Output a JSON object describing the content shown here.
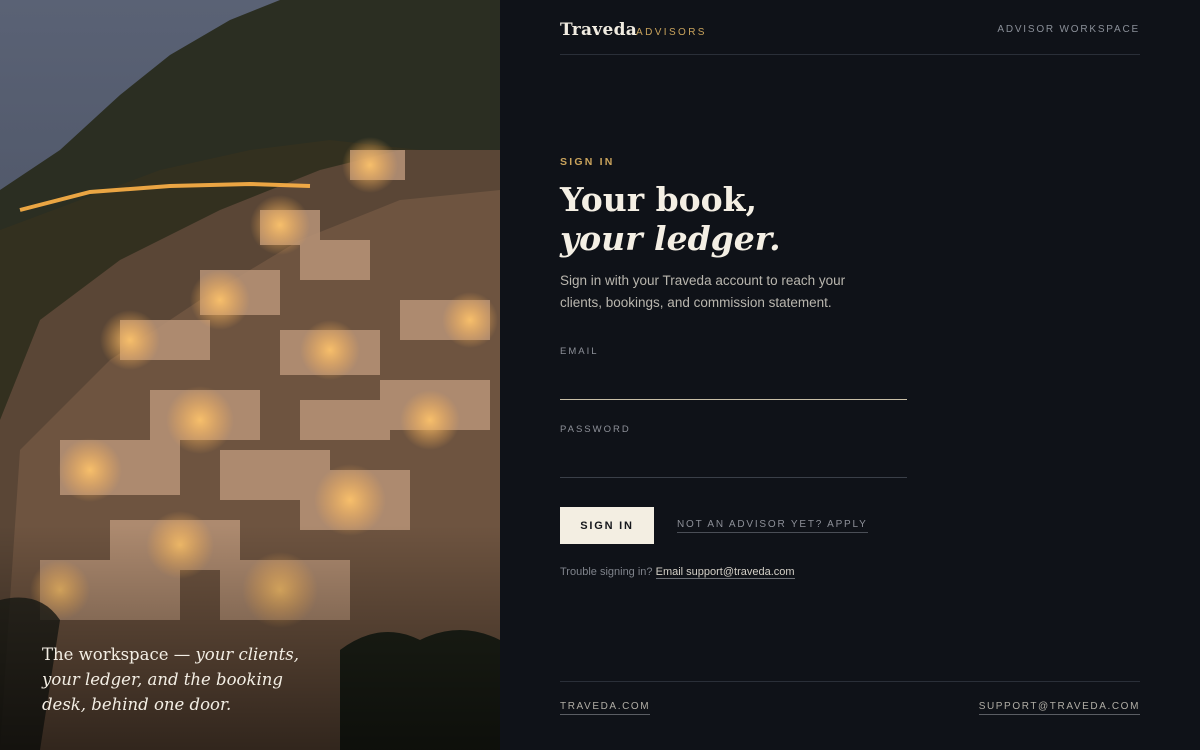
{
  "hero": {
    "caption_plain": "The workspace — ",
    "caption_italic": "your clients, your ledger, and the booking desk, behind one door."
  },
  "header": {
    "brand": "Traveda",
    "brand_sub": "ADVISORS",
    "workspace": "ADVISOR WORKSPACE"
  },
  "signin": {
    "eyebrow": "SIGN IN",
    "title_line1": "Your book,",
    "title_line2": "your ledger.",
    "intro": "Sign in with your Traveda account to reach your clients, bookings, and commission statement.",
    "email_label": "EMAIL",
    "email_value": "",
    "password_label": "PASSWORD",
    "password_value": "",
    "submit_label": "SIGN IN",
    "apply_link": "NOT AN ADVISOR YET? APPLY",
    "trouble_text": "Trouble signing in?",
    "support_link": "Email support@traveda.com"
  },
  "footer": {
    "site_link": "TRAVEDA.COM",
    "support_link": "SUPPORT@TRAVEDA.COM"
  },
  "colors": {
    "background": "#0f1218",
    "accent_gold": "#c9a35c",
    "button_bg": "#f3eee2"
  }
}
